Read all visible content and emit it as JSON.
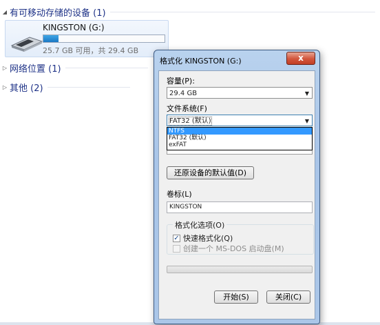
{
  "explorer": {
    "groups": [
      {
        "title": "有可移动存储的设备 (1)",
        "arrow": "◢"
      },
      {
        "title": "网络位置 (1)",
        "arrow": "▷"
      },
      {
        "title": "其他 (2)",
        "arrow": "▷"
      }
    ],
    "drive": {
      "name": "KINGSTON (G:)",
      "space": "25.7 GB 可用，共 29.4 GB",
      "used_fraction": 0.126
    }
  },
  "dialog": {
    "title": "格式化 KINGSTON (G:)",
    "close_glyph": "x",
    "capacity_label": "容量(P):",
    "capacity_value": "29.4 GB",
    "filesystem_label": "文件系统(F)",
    "filesystem_value": "FAT32 (默认)",
    "filesystem_options": [
      "NTFS",
      "FAT32 (默认)",
      "exFAT"
    ],
    "filesystem_highlighted": "NTFS",
    "restore_button": "还原设备的默认值(D)",
    "volume_label": "卷标(L)",
    "volume_value": "KINGSTON",
    "options_legend": "格式化选项(O)",
    "quick_format": "快速格式化(Q)",
    "quick_format_checked": true,
    "msdos_disk": "创建一个 MS-DOS 启动盘(M)",
    "msdos_checked": false,
    "progress": 0,
    "start_button": "开始(S)",
    "close_button": "关闭(C)"
  },
  "colors": {
    "accent": "#1e3287",
    "selection": "#3399ff",
    "close_red": "#c13f25"
  }
}
